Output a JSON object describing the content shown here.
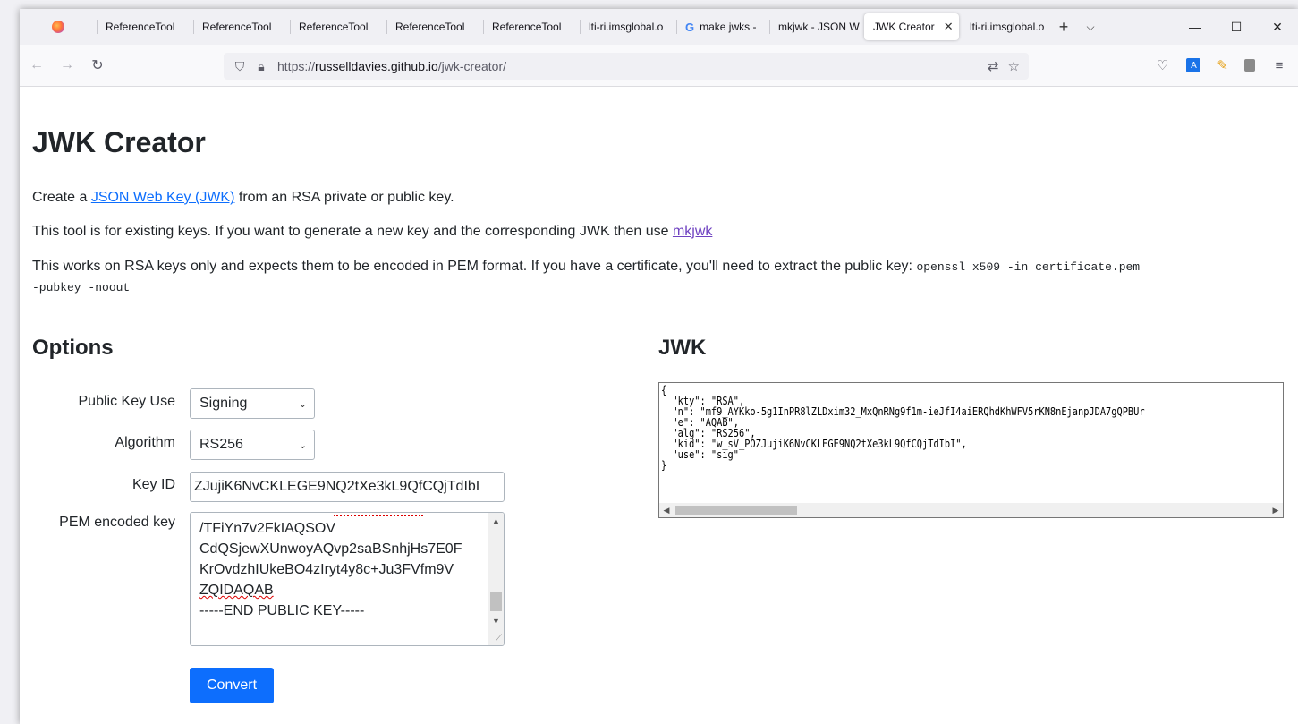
{
  "tabs": [
    {
      "label": "ReferenceTool"
    },
    {
      "label": "ReferenceTool"
    },
    {
      "label": "ReferenceTool"
    },
    {
      "label": "ReferenceTool"
    },
    {
      "label": "ReferenceTool"
    },
    {
      "label": "lti-ri.imsglobal.o"
    },
    {
      "label": "make jwks -"
    },
    {
      "label": "mkjwk - JSON W"
    },
    {
      "label": "JWK Creator",
      "active": true
    },
    {
      "label": "lti-ri.imsglobal.o"
    }
  ],
  "window_controls": {
    "minimize": "—",
    "maximize": "☐",
    "close": "✕"
  },
  "nav": {
    "url_domain": "russelldavies.github.io",
    "url_prefix": "https://",
    "url_path": "/jwk-creator/"
  },
  "page": {
    "title": "JWK Creator",
    "intro_prefix": "Create a ",
    "intro_link": "JSON Web Key (JWK)",
    "intro_suffix": " from an RSA private or public key.",
    "tool_text": "This tool is for existing keys. If you want to generate a new key and the corresponding JWK then use ",
    "tool_link": "mkjwk",
    "rsa_text": "This works on RSA keys only and expects them to be encoded in PEM format. If you have a certificate, you'll need to extract the public key: ",
    "rsa_code_1": "openssl x509 -in certificate.pem",
    "rsa_code_2": "-pubkey -noout"
  },
  "options": {
    "heading": "Options",
    "public_key_use_label": "Public Key Use",
    "public_key_use_value": "Signing",
    "algorithm_label": "Algorithm",
    "algorithm_value": "RS256",
    "key_id_label": "Key ID",
    "key_id_value": "ZJujiK6NvCKLEGE9NQ2tXe3kL9QfCQjTdIbI",
    "pem_label": "PEM encoded key",
    "pem_lines": [
      "/TFiYn7v2FkIAQSOV",
      "CdQSjewXUnwoyAQvp2saBSnhjHs7E0F",
      "KrOvdzhIUkeBO4zIryt4y8c+Ju3FVfm9V",
      "ZQIDAQAB",
      "-----END PUBLIC KEY-----"
    ],
    "convert_label": "Convert"
  },
  "jwk": {
    "heading": "JWK",
    "output": "{\n  \"kty\": \"RSA\",\n  \"n\": \"mf9_AYKko-5g1InPR8lZLDxim32_MxQnRNg9f1m-ieJfI4aiERQhdKhWFV5rKN8nEjanpJDA7gQPBUr\n  \"e\": \"AQAB\",\n  \"alg\": \"RS256\",\n  \"kid\": \"w_sV_POZJujiK6NvCKLEGE9NQ2tXe3kL9QfCQjTdIbI\",\n  \"use\": \"sig\"\n}"
  }
}
